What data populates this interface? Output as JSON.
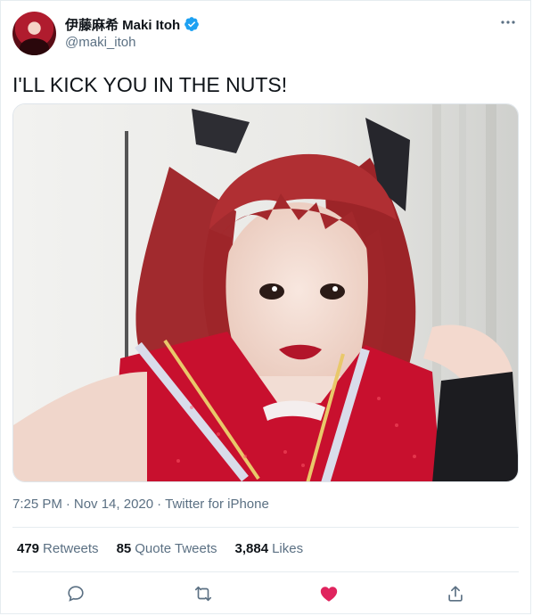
{
  "author": {
    "display_name": "伊藤麻希 Maki Itoh",
    "handle": "@maki_itoh",
    "verified": true,
    "avatar": "avatar-photo"
  },
  "tweet": {
    "text": "I'LL KICK YOU IN THE NUTS!",
    "media": "photo-selfie-red-hair"
  },
  "meta": {
    "time": "7:25 PM",
    "sep1": "·",
    "date": "Nov 14, 2020",
    "sep2": "·",
    "source": "Twitter for iPhone"
  },
  "stats": {
    "retweets_count": "479",
    "retweets_label": "Retweets",
    "quotes_count": "85",
    "quotes_label": "Quote Tweets",
    "likes_count": "3,884",
    "likes_label": "Likes"
  },
  "actions": {
    "reply": "reply-icon",
    "retweet": "retweet-icon",
    "like": "heart-icon",
    "share": "share-icon",
    "liked": true
  },
  "colors": {
    "accent": "#1da1f2",
    "like": "#e0245e",
    "secondary_text": "#5b7083",
    "retweet_green": "#17bf63"
  }
}
